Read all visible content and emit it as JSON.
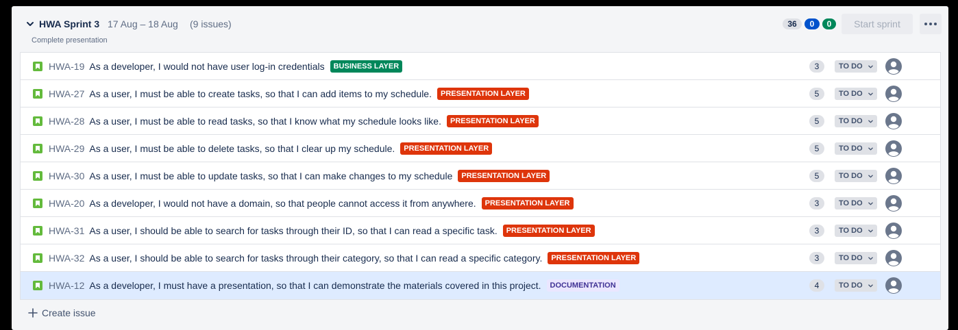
{
  "sprint": {
    "name": "HWA Sprint 3",
    "dates": "17 Aug – 18 Aug",
    "issue_count": "(9 issues)",
    "goal": "Complete presentation",
    "counts": {
      "todo": "36",
      "in_progress": "0",
      "done": "0"
    },
    "start_label": "Start sprint",
    "more_icon": "more-icon"
  },
  "issues": [
    {
      "key": "HWA-19",
      "summary": "As a developer, I would not have user log-in credentials",
      "epic": "BUSINESS LAYER",
      "epic_type": "business",
      "points": "3",
      "status": "TO DO"
    },
    {
      "key": "HWA-27",
      "summary": "As a user, I must be able to create tasks, so that I can add items to my schedule.",
      "epic": "PRESENTATION LAYER",
      "epic_type": "presentation",
      "points": "5",
      "status": "TO DO"
    },
    {
      "key": "HWA-28",
      "summary": "As a user, I must be able to read tasks, so that I know what my schedule looks like.",
      "epic": "PRESENTATION LAYER",
      "epic_type": "presentation",
      "points": "5",
      "status": "TO DO"
    },
    {
      "key": "HWA-29",
      "summary": "As a user, I must be able to delete tasks, so that I clear up my schedule.",
      "epic": "PRESENTATION LAYER",
      "epic_type": "presentation",
      "points": "5",
      "status": "TO DO"
    },
    {
      "key": "HWA-30",
      "summary": "As a user, I must be able to update tasks, so that I can make changes to my schedule",
      "epic": "PRESENTATION LAYER",
      "epic_type": "presentation",
      "points": "5",
      "status": "TO DO"
    },
    {
      "key": "HWA-20",
      "summary": "As a developer, I would not have a domain, so that people cannot access it from anywhere.",
      "epic": "PRESENTATION LAYER",
      "epic_type": "presentation",
      "points": "3",
      "status": "TO DO"
    },
    {
      "key": "HWA-31",
      "summary": "As a user, I should be able to search for tasks through their ID, so that I can read a specific task.",
      "epic": "PRESENTATION LAYER",
      "epic_type": "presentation",
      "points": "3",
      "status": "TO DO"
    },
    {
      "key": "HWA-32",
      "summary": "As a user, I should be able to search for tasks through their category, so that I can read a specific category.",
      "epic": "PRESENTATION LAYER",
      "epic_type": "presentation",
      "points": "3",
      "status": "TO DO"
    },
    {
      "key": "HWA-12",
      "summary": "As a developer, I must have a presentation, so that I can demonstrate the materials covered in this project.",
      "epic": "DOCUMENTATION",
      "epic_type": "documentation",
      "points": "4",
      "status": "TO DO"
    }
  ],
  "create_issue_label": "Create issue",
  "colors": {
    "business": "#00875a",
    "presentation": "#de350b",
    "documentation_bg": "#eae6ff",
    "documentation_fg": "#403294",
    "story": "#63ba3c",
    "selected_row": "#deebff"
  }
}
